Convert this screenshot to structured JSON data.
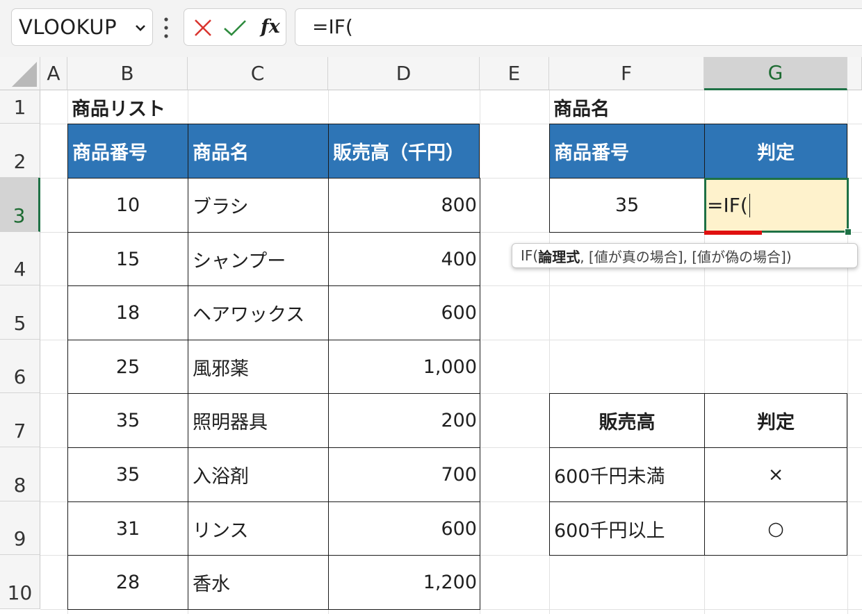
{
  "formula_bar": {
    "name_box": "VLOOKUP",
    "formula": "=IF("
  },
  "columns": [
    "A",
    "B",
    "C",
    "D",
    "E",
    "F",
    "G"
  ],
  "rows": [
    "1",
    "2",
    "3",
    "4",
    "5",
    "6",
    "7",
    "8",
    "9",
    "10"
  ],
  "selected_column": "G",
  "selected_row": "3",
  "product_list": {
    "title": "商品リスト",
    "headers": [
      "商品番号",
      "商品名",
      "販売高（千円）"
    ],
    "items": [
      [
        "10",
        "ブラシ",
        "800"
      ],
      [
        "15",
        "シャンプー",
        "400"
      ],
      [
        "18",
        "ヘアワックス",
        "600"
      ],
      [
        "25",
        "風邪薬",
        "1,000"
      ],
      [
        "35",
        "照明器具",
        "200"
      ],
      [
        "35",
        "入浴剤",
        "700"
      ],
      [
        "31",
        "リンス",
        "600"
      ],
      [
        "28",
        "香水",
        "1,200"
      ]
    ]
  },
  "lookup": {
    "title": "商品名",
    "headers": [
      "商品番号",
      "判定"
    ],
    "product_number": "35",
    "editing_value": "=IF("
  },
  "tooltip": {
    "prefix": "IF(",
    "bold_arg": "論理式",
    "rest": ", [値が真の場合], [値が偽の場合])"
  },
  "criteria": {
    "headers": [
      "販売高",
      "判定"
    ],
    "rows": [
      [
        "600千円未満",
        "×"
      ],
      [
        "600千円以上",
        "○"
      ]
    ]
  },
  "colors": {
    "header_blue": "#2e75b6",
    "selection_green": "#1e7145",
    "active_fill": "#fef2cc",
    "error_red": "#e01010"
  }
}
